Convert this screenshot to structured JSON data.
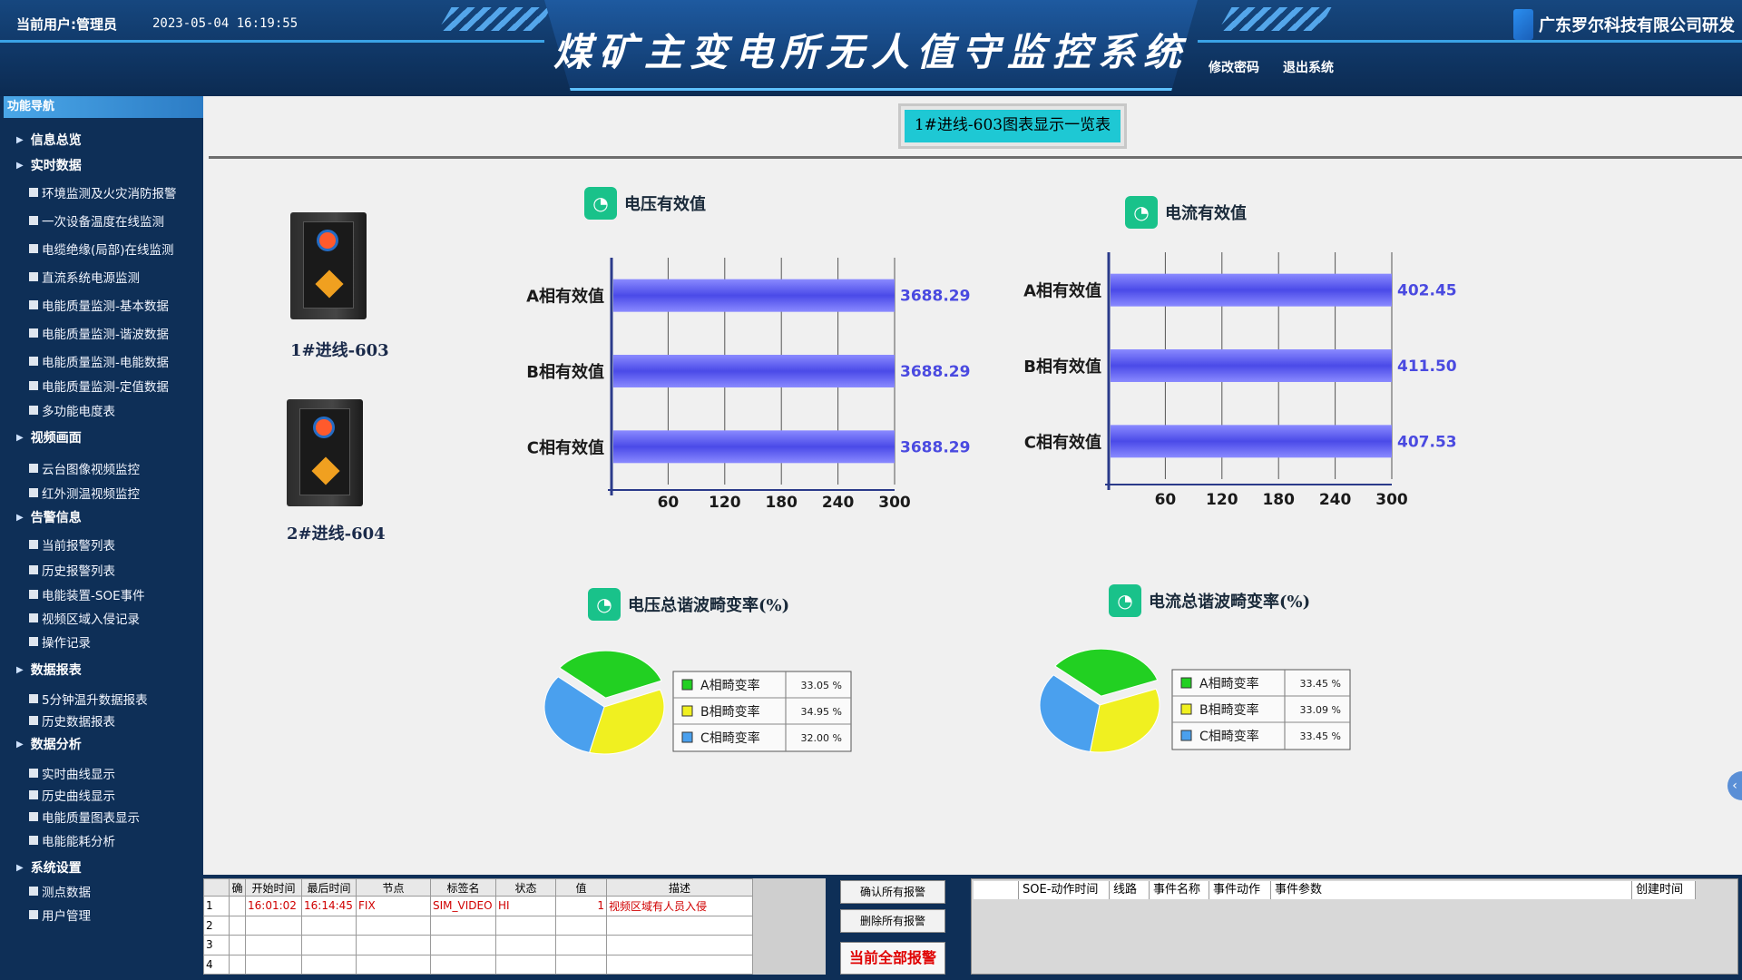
{
  "header": {
    "current_user": "当前用户:管理员",
    "datetime": "2023-05-04 16:19:55",
    "title": "煤矿主变电所无人值守监控系统",
    "company": "广东罗尔科技有限公司研发",
    "change_password": "修改密码",
    "logout": "退出系统"
  },
  "sidebar": {
    "title": "功能导航",
    "groups": {
      "info_overview": "信息总览",
      "realtime": "实时数据",
      "video": "视频画面",
      "alarm": "告警信息",
      "report": "数据报表",
      "analysis": "数据分析",
      "settings": "系统设置"
    },
    "items": {
      "env": "环境监测及火灾消防报警",
      "temp": "一次设备温度在线监测",
      "cable": "电缆绝缘(局部)在线监测",
      "dc": "直流系统电源监测",
      "pq_basic": "电能质量监测-基本数据",
      "pq_harm": "电能质量监测-谐波数据",
      "pq_energy": "电能质量监测-电能数据",
      "pq_set": "电能质量监测-定值数据",
      "meter": "多功能电度表",
      "ptz": "云台图像视频监控",
      "ir": "红外测温视频监控",
      "cur_alarm": "当前报警列表",
      "hist_alarm": "历史报警列表",
      "soe": "电能装置-SOE事件",
      "intrusion": "视频区域入侵记录",
      "oplog": "操作记录",
      "rep5": "5分钟温升数据报表",
      "rephist": "历史数据报表",
      "rt_curve": "实时曲线显示",
      "hist_curve": "历史曲线显示",
      "pq_chart": "电能质量图表显示",
      "energy": "电能能耗分析",
      "points": "测点数据",
      "users": "用户管理"
    }
  },
  "main": {
    "title": "1#进线-603图表显示一览表",
    "devices": [
      "1#进线-603",
      "2#进线-604"
    ],
    "voltage_title": "电压有效值",
    "current_title": "电流有效值",
    "voltage_thd_title": "电压总谐波畸变率(%)",
    "current_thd_title": "电流总谐波畸变率(%)"
  },
  "chart_data": [
    {
      "type": "bar",
      "orientation": "horizontal",
      "title": "电压有效值",
      "categories": [
        "A相有效值",
        "B相有效值",
        "C相有效值"
      ],
      "values": [
        3688.29,
        3688.29,
        3688.29
      ],
      "value_labels": [
        "3688.29",
        "3688.29",
        "3688.29"
      ],
      "ticks": [
        60,
        120,
        180,
        240,
        300
      ],
      "xlim": [
        0,
        300
      ],
      "color": "#5b5bf0",
      "grid": true
    },
    {
      "type": "bar",
      "orientation": "horizontal",
      "title": "电流有效值",
      "categories": [
        "A相有效值",
        "B相有效值",
        "C相有效值"
      ],
      "values": [
        402.45,
        411.5,
        407.53
      ],
      "value_labels": [
        "402.45",
        "411.50",
        "407.53"
      ],
      "ticks": [
        60,
        120,
        180,
        240,
        300
      ],
      "xlim": [
        0,
        300
      ],
      "color": "#5b5bf0",
      "grid": true
    },
    {
      "type": "pie",
      "title": "电压总谐波畸变率(%)",
      "labels": [
        "A相畸变率",
        "B相畸变率",
        "C相畸变率"
      ],
      "values": [
        33.05,
        34.95,
        32.0
      ],
      "value_labels": [
        "33.05 %",
        "34.95 %",
        "32.00 %"
      ],
      "colors": [
        "#22d022",
        "#f0f020",
        "#4aa0ee"
      ],
      "legend": "right"
    },
    {
      "type": "pie",
      "title": "电流总谐波畸变率(%)",
      "labels": [
        "A相畸变率",
        "B相畸变率",
        "C相畸变率"
      ],
      "values": [
        33.45,
        33.09,
        33.45
      ],
      "value_labels": [
        "33.45 %",
        "33.09 %",
        "33.45 %"
      ],
      "colors": [
        "#22d022",
        "#f0f020",
        "#4aa0ee"
      ],
      "legend": "right"
    }
  ],
  "alarm": {
    "columns": [
      "确",
      "开始时间",
      "最后时间",
      "节点",
      "标签名",
      "状态",
      "值",
      "描述"
    ],
    "rows": [
      {
        "no": "1",
        "ack": "",
        "start": "16:01:02",
        "last": "16:14:45",
        "node": "FIX",
        "tag": "SIM_VIDEO",
        "state": "HI",
        "value": "1",
        "desc": "视频区域有人员入侵"
      },
      {
        "no": "2",
        "ack": "",
        "start": "",
        "last": "",
        "node": "",
        "tag": "",
        "state": "",
        "value": "",
        "desc": ""
      },
      {
        "no": "3",
        "ack": "",
        "start": "",
        "last": "",
        "node": "",
        "tag": "",
        "state": "",
        "value": "",
        "desc": ""
      },
      {
        "no": "4",
        "ack": "",
        "start": "",
        "last": "",
        "node": "",
        "tag": "",
        "state": "",
        "value": "",
        "desc": ""
      }
    ],
    "btn_ack_all": "确认所有报警",
    "btn_delete_all": "删除所有报警",
    "btn_current": "当前全部报警",
    "soe_columns": [
      "SOE-动作时间",
      "线路",
      "事件名称",
      "事件动作",
      "事件参数",
      "创建时间"
    ]
  }
}
